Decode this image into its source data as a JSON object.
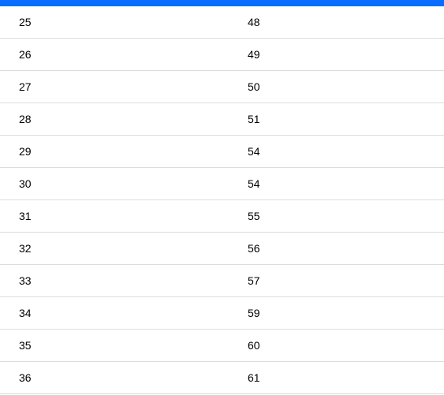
{
  "rows": [
    {
      "left": "25",
      "right": "48"
    },
    {
      "left": "26",
      "right": "49"
    },
    {
      "left": "27",
      "right": "50"
    },
    {
      "left": "28",
      "right": "51"
    },
    {
      "left": "29",
      "right": "54"
    },
    {
      "left": "30",
      "right": "54"
    },
    {
      "left": "31",
      "right": "55"
    },
    {
      "left": "32",
      "right": "56"
    },
    {
      "left": "33",
      "right": "57"
    },
    {
      "left": "34",
      "right": "59"
    },
    {
      "left": "35",
      "right": "60"
    },
    {
      "left": "36",
      "right": "61"
    }
  ]
}
